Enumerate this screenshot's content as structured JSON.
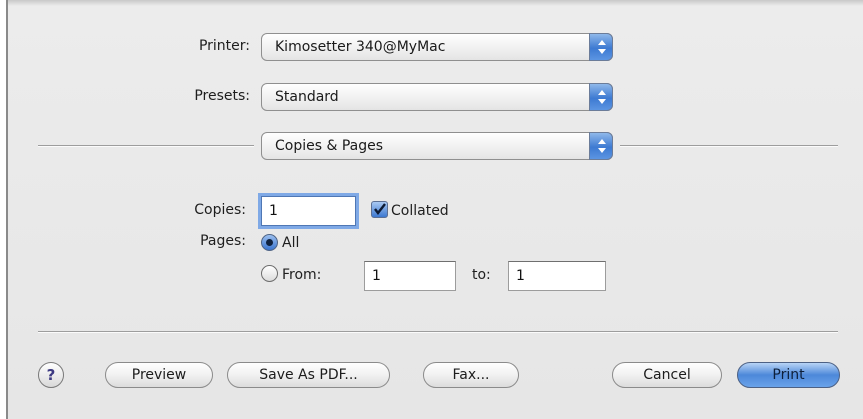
{
  "printer": {
    "label": "Printer:",
    "value": "Kimosetter 340@MyMac"
  },
  "presets": {
    "label": "Presets:",
    "value": "Standard"
  },
  "pane": {
    "value": "Copies & Pages"
  },
  "copies": {
    "label": "Copies:",
    "value": "1",
    "collated_label": "Collated",
    "collated_checked": true
  },
  "pages": {
    "label": "Pages:",
    "all_label": "All",
    "from_label": "From:",
    "from_value": "1",
    "to_label": "to:",
    "to_value": "1",
    "selected": "All"
  },
  "buttons": {
    "help": "?",
    "preview": "Preview",
    "save_pdf": "Save As PDF...",
    "fax": "Fax...",
    "cancel": "Cancel",
    "print": "Print"
  },
  "colors": {
    "accent": "#3d7ad2",
    "background": "#e9e9e9"
  }
}
